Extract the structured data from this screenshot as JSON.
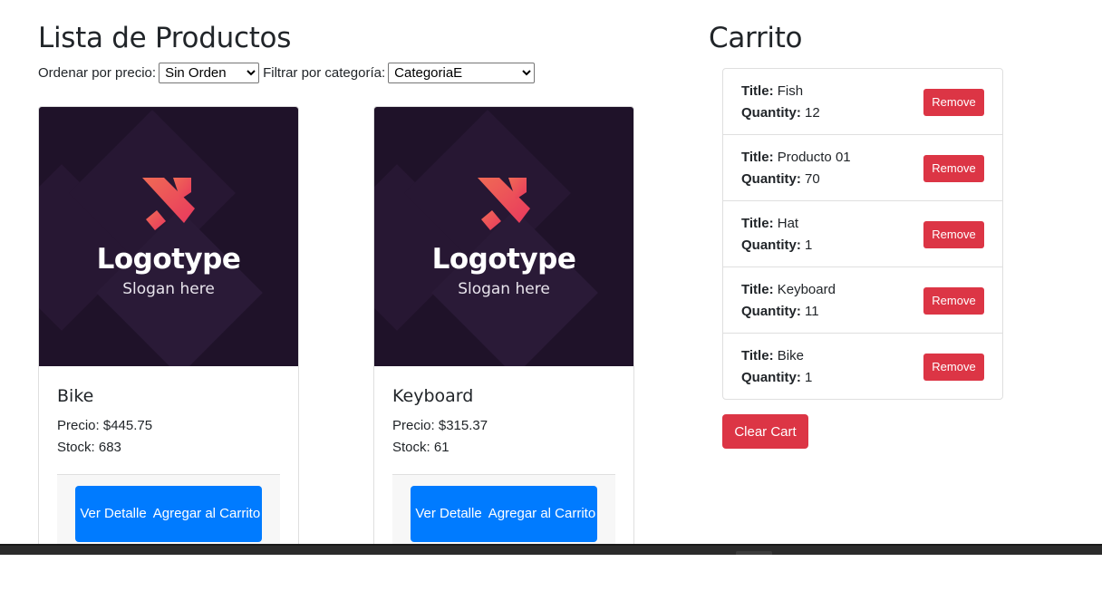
{
  "products_section": {
    "title": "Lista de Productos",
    "sort_label": "Ordenar por precio:",
    "sort_value": "Sin Orden",
    "filter_label": "Filtrar por categoría:",
    "filter_value": "CategoriaE"
  },
  "products": [
    {
      "image": {
        "logo_text": "Logotype",
        "slogan": "Slogan here"
      },
      "name": "Bike",
      "price": "Precio: $445.75",
      "stock": "Stock: 683",
      "detail_label": "Ver Detalle",
      "add_label": "Agregar al Carrito"
    },
    {
      "image": {
        "logo_text": "Logotype",
        "slogan": "Slogan here"
      },
      "name": "Keyboard",
      "price": "Precio: $315.37",
      "stock": "Stock: 61",
      "detail_label": "Ver Detalle",
      "add_label": "Agregar al Carrito"
    }
  ],
  "cart": {
    "title": "Carrito",
    "title_key": "Title:",
    "quantity_key": "Quantity:",
    "remove_label": "Remove",
    "clear_label": "Clear Cart",
    "items": [
      {
        "title": "Fish",
        "quantity": "12"
      },
      {
        "title": "Producto 01",
        "quantity": "70"
      },
      {
        "title": "Hat",
        "quantity": "1"
      },
      {
        "title": "Keyboard",
        "quantity": "11"
      },
      {
        "title": "Bike",
        "quantity": "1"
      }
    ]
  },
  "colors": {
    "primary": "#007bff",
    "danger": "#dc3545",
    "image_bg": "#1f1229",
    "logo_accent": "#ef4f5b"
  }
}
